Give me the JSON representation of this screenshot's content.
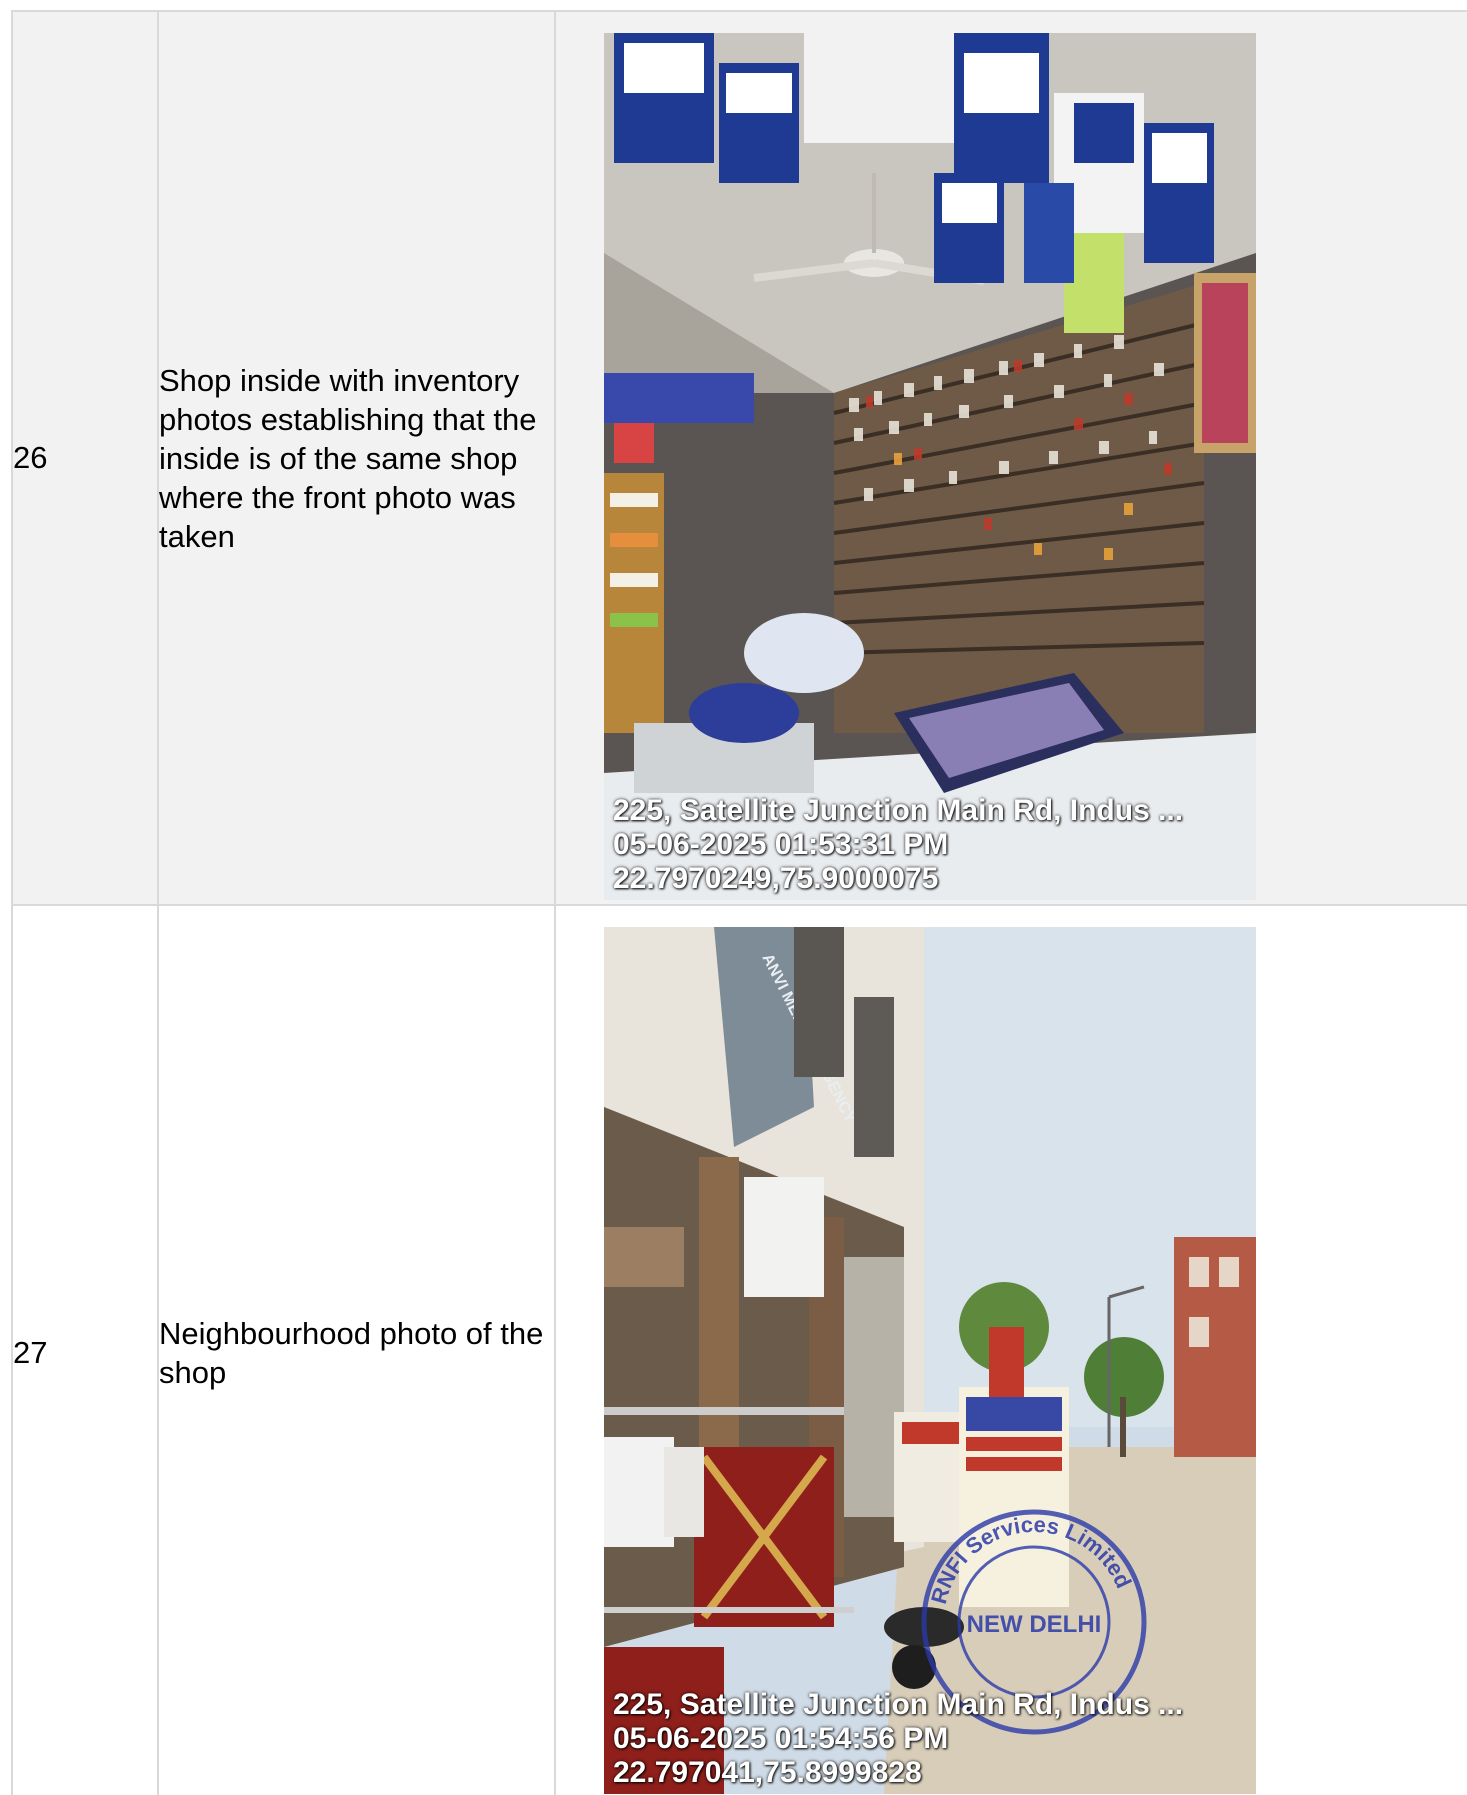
{
  "rows": [
    {
      "number": "26",
      "description": "Shop inside with inventory photos establishing that the inside is of the same shop where the front photo was taken",
      "photo": {
        "subject": "pharmacy-interior",
        "address_line": "225, Satellite Junction Main Rd, Indus ...",
        "timestamp_line": "05-06-2025 01:53:31 PM",
        "coords_line": "22.7970249,75.9000075"
      }
    },
    {
      "number": "27",
      "description": "Neighbourhood photo of the shop",
      "photo": {
        "subject": "street-view",
        "sign_text": "ANVI MEDICAL AGENCY",
        "address_line": "225, Satellite Junction Main Rd, Indus ...",
        "timestamp_line": "05-06-2025 01:54:56 PM",
        "coords_line": "22.797041,75.8999828",
        "stamp": {
          "outer_text": "RNFI Services Limited",
          "center_text": "NEW DELHI",
          "color": "#2b3aa8"
        }
      }
    }
  ],
  "colors": {
    "row_shade": "#f2f2f2",
    "border": "#d9d9d9"
  }
}
